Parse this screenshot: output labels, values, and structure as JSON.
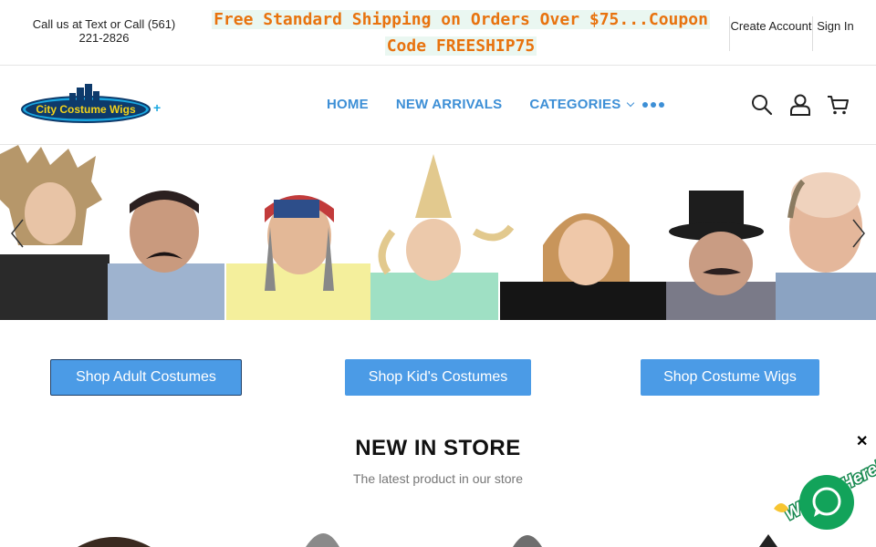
{
  "topbar": {
    "phone": "Call us at Text or Call (561) 221-2826",
    "promo_line1": "Free Standard Shipping on Orders Over $75...Coupon",
    "promo_line2": "Code FREESHIP75",
    "create_account": "Create Account",
    "sign_in": "Sign In"
  },
  "header": {
    "logo_text": "City Costume Wigs",
    "nav": [
      {
        "label": "HOME"
      },
      {
        "label": "NEW ARRIVALS"
      },
      {
        "label": "CATEGORIES"
      }
    ],
    "more_icon": "ellipsis-icon",
    "icons": [
      "search-icon",
      "user-icon",
      "cart-icon"
    ]
  },
  "hero": {
    "people_count": 8
  },
  "cta": {
    "adult": "Shop Adult Costumes",
    "kids": "Shop Kid's Costumes",
    "wigs": "Shop Costume Wigs"
  },
  "section": {
    "title": "NEW IN STORE",
    "subtitle": "The latest product in our store"
  },
  "chat": {
    "badge_text": "We Are Here!",
    "close": "✕"
  },
  "colors": {
    "accent": "#3d8fd6",
    "button": "#4b9be6",
    "promo": "#e8730f",
    "chat": "#12a35a"
  }
}
